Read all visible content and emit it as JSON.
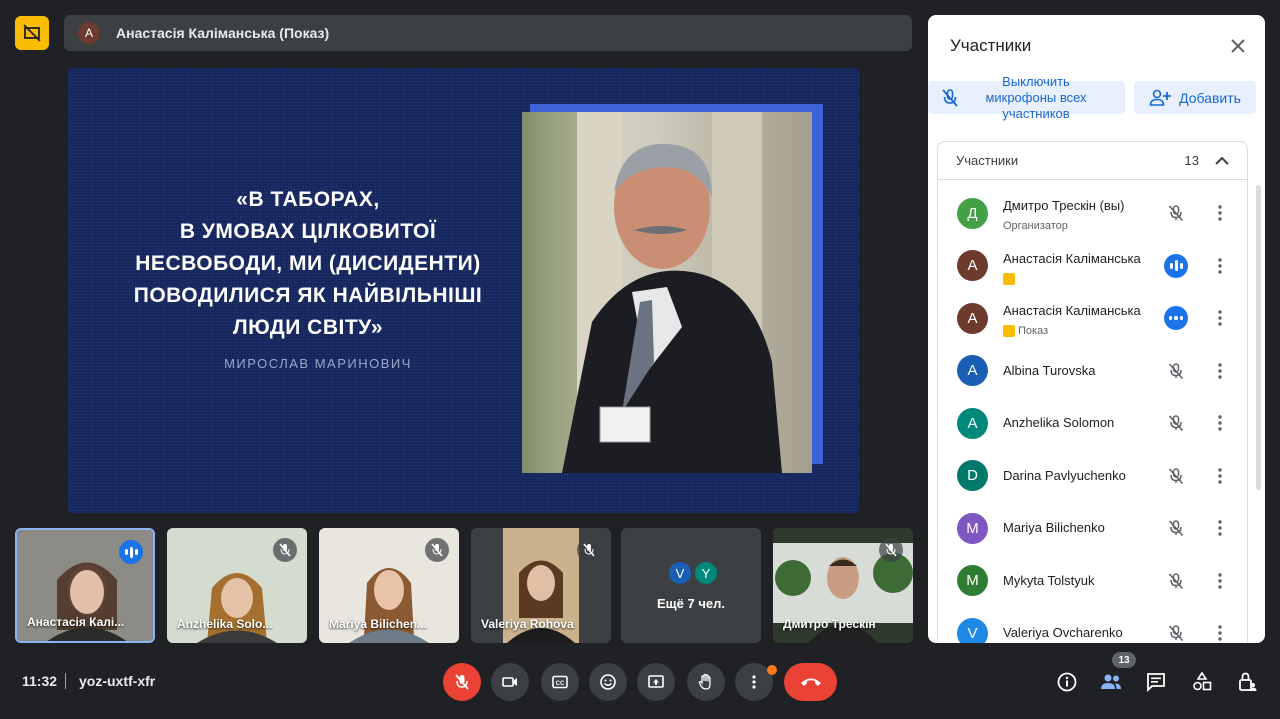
{
  "top": {
    "presenter_initial": "A",
    "presenter_label": "Анастасія Каліманська (Показ)"
  },
  "slide": {
    "quote_lines": [
      "«В ТАБОРАХ,",
      "В УМОВАХ ЦІЛКОВИТОЇ",
      "НЕСВОБОДИ, МИ (ДИСИДЕНТИ)",
      "ПОВОДИЛИСЯ ЯК НАЙВІЛЬНІШІ",
      "ЛЮДИ СВІТУ»"
    ],
    "author": "МИРОСЛАВ МАРИНОВИЧ"
  },
  "thumbs": [
    {
      "name": "Анастасія Калі...",
      "state": "speaking"
    },
    {
      "name": "Anzhelika Solo...",
      "state": "muted"
    },
    {
      "name": "Mariya Bilichen...",
      "state": "muted"
    },
    {
      "name": "Valeriya Rohova",
      "state": "muted"
    },
    {
      "more_label": "Ещё 7 чел.",
      "initials": [
        "V",
        "Y"
      ]
    },
    {
      "name": "Дмитро Трескін",
      "state": "muted"
    }
  ],
  "bottom": {
    "time": "11:32",
    "meeting_code": "yoz-uxtf-xfr",
    "participants_badge": "13"
  },
  "panel": {
    "title": "Участники",
    "mute_all_label": "Выключить микрофоны всех участников",
    "add_label": "Добавить",
    "section_label": "Участники",
    "section_count": "13",
    "participants": [
      {
        "initial": "Д",
        "name": "Дмитро Трескін (вы)",
        "sub": "Организатор",
        "color": "#43a047",
        "status": "muted"
      },
      {
        "initial": "А",
        "name": "Анастасія Каліманська",
        "sub": "",
        "color": "#6d3b2e",
        "status": "speaking",
        "badge": true
      },
      {
        "initial": "А",
        "name": "Анастасія Каліманська",
        "sub": "Показ",
        "color": "#6d3b2e",
        "status": "presenting",
        "badge": true
      },
      {
        "initial": "A",
        "name": "Albina Turovska",
        "sub": "",
        "color": "#1a5fb4",
        "status": "muted"
      },
      {
        "initial": "A",
        "name": "Anzhelika Solomon",
        "sub": "",
        "color": "#00897b",
        "status": "muted"
      },
      {
        "initial": "D",
        "name": "Darina Pavlyuchenko",
        "sub": "",
        "color": "#00796b",
        "status": "muted"
      },
      {
        "initial": "M",
        "name": "Mariya Bilichenko",
        "sub": "",
        "color": "#7e57c2",
        "status": "muted"
      },
      {
        "initial": "M",
        "name": "Mykyta Tolstyuk",
        "sub": "",
        "color": "#2e7d32",
        "status": "muted"
      },
      {
        "initial": "V",
        "name": "Valeriya Ovcharenko",
        "sub": "",
        "color": "#1e88e5",
        "status": "muted"
      }
    ]
  },
  "colors": {
    "accent": "#1a73e8",
    "danger": "#ea4335",
    "present": "#fbbc04"
  }
}
